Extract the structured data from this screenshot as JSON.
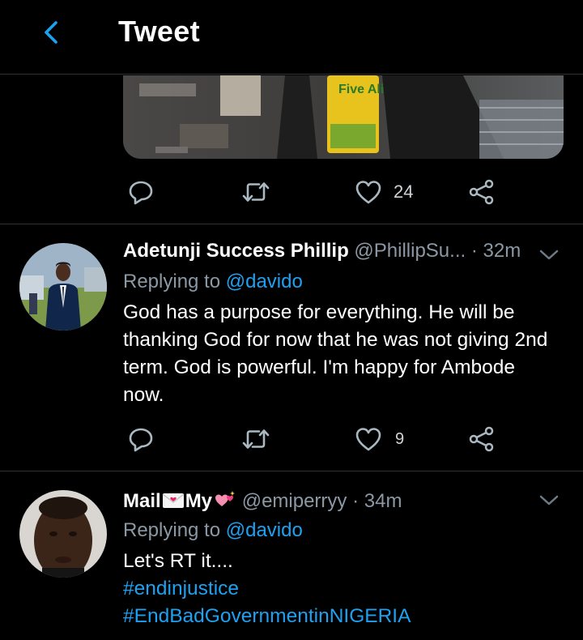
{
  "header": {
    "title": "Tweet"
  },
  "top_tweet": {
    "media_text": "Five Alive",
    "like_count": "24"
  },
  "replies": [
    {
      "name": "Adetunji Success Phillip",
      "handle": "@PhillipSu...",
      "time": "· 32m",
      "replying_prefix": "Replying to",
      "replying_to": "@davido",
      "text_lines": [
        "God has a purpose for everything. He will be",
        "thanking God for now that he was not giving 2nd",
        "term. God is powerful. I'm happy for Ambode",
        "now."
      ],
      "like_count": "9"
    },
    {
      "name_part1": "Mail",
      "name_part2": "My",
      "handle": "@emiperryy",
      "time": "· 34m",
      "replying_prefix": "Replying to",
      "replying_to": "@davido",
      "text_lines": [
        "Let's RT it...."
      ],
      "hashtags": [
        "#endinjustice",
        "#EndBadGovernmentinNIGERIA"
      ]
    }
  ],
  "colors": {
    "background": "#000000",
    "accent": "#1da1f2",
    "secondary_text": "#8b98a5",
    "icon": "#aab8c2",
    "divider": "#2f3336"
  },
  "icons": [
    "back-arrow-icon",
    "reply-icon",
    "retweet-icon",
    "like-icon",
    "share-icon",
    "chevron-down-icon",
    "love-letter-emoji",
    "sparkling-hearts-emoji"
  ]
}
